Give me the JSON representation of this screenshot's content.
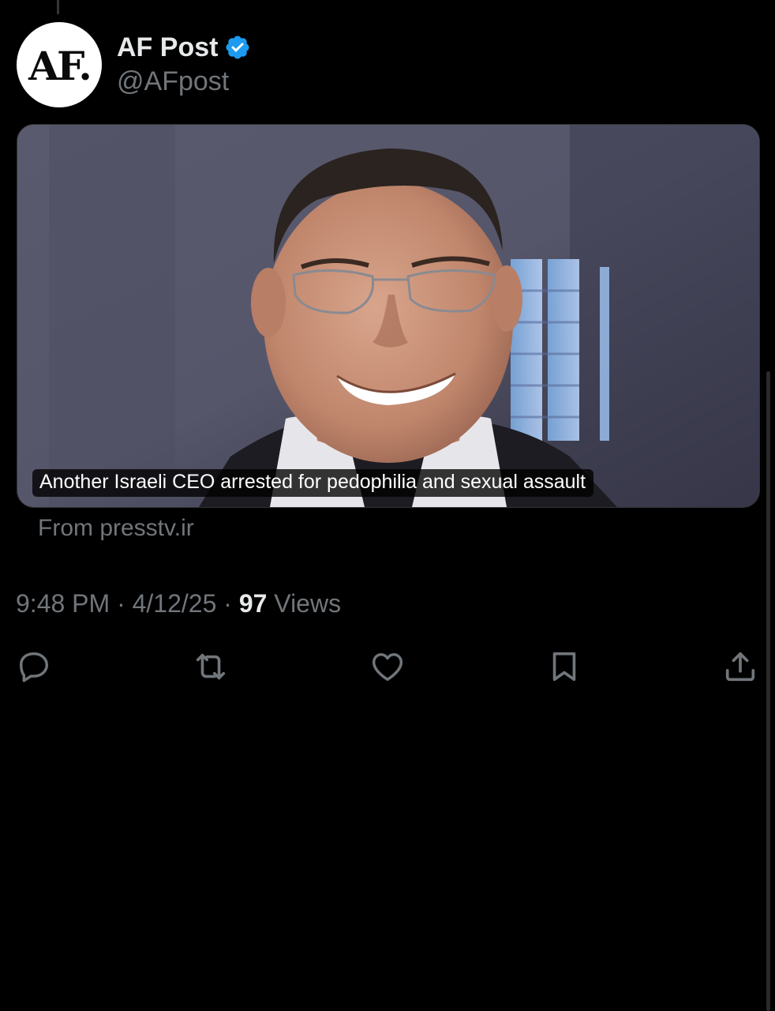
{
  "author": {
    "avatar_text": "AF.",
    "display_name": "AF Post",
    "handle": "@AFpost",
    "verified_color": "#1d9bf0"
  },
  "media": {
    "caption": "Another Israeli CEO arrested for pedophilia and sexual assault"
  },
  "source": "From presstv.ir",
  "meta": {
    "time": "9:48 PM",
    "separator": "·",
    "date": "4/12/25",
    "views_count": "97",
    "views_label": "Views"
  },
  "actions": {
    "reply_icon": "reply-icon",
    "repost_icon": "repost-icon",
    "like_icon": "heart-icon",
    "bookmark_icon": "bookmark-icon",
    "share_icon": "share-icon"
  },
  "colors": {
    "background": "#000000",
    "primary_text": "#e7e9ea",
    "secondary_text": "#71767b",
    "accent": "#1d9bf0"
  }
}
